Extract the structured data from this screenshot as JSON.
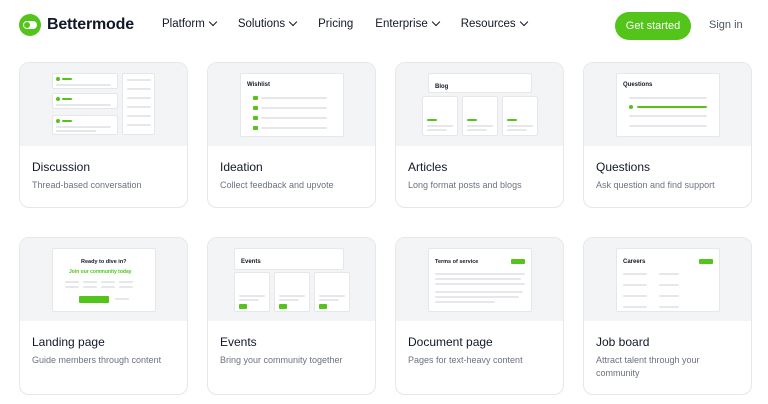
{
  "header": {
    "brand": "Bettermode",
    "nav": [
      {
        "label": "Platform",
        "dropdown": true
      },
      {
        "label": "Solutions",
        "dropdown": true
      },
      {
        "label": "Pricing",
        "dropdown": false
      },
      {
        "label": "Enterprise",
        "dropdown": true
      },
      {
        "label": "Resources",
        "dropdown": true
      }
    ],
    "cta": "Get started",
    "signin": "Sign in"
  },
  "templates": [
    {
      "title": "Discussion",
      "desc": "Thread-based conversation"
    },
    {
      "title": "Ideation",
      "desc": "Collect feedback and upvote",
      "thumb_heading": "Wishlist"
    },
    {
      "title": "Articles",
      "desc": "Long format posts and blogs",
      "thumb_heading": "Blog"
    },
    {
      "title": "Questions",
      "desc": "Ask question and find support",
      "thumb_heading": "Questions"
    },
    {
      "title": "Landing page",
      "desc": "Guide members through content",
      "thumb_heading": "Ready to dive in?",
      "thumb_sub": "Join our community today"
    },
    {
      "title": "Events",
      "desc": "Bring your community together",
      "thumb_heading": "Events"
    },
    {
      "title": "Document page",
      "desc": "Pages for text-heavy content",
      "thumb_heading": "Terms of service"
    },
    {
      "title": "Job board",
      "desc": "Attract talent through your community",
      "thumb_heading": "Careers"
    }
  ],
  "colors": {
    "accent": "#52c41a",
    "card_border": "#e5e7eb",
    "thumb_bg": "#f3f4f6"
  }
}
